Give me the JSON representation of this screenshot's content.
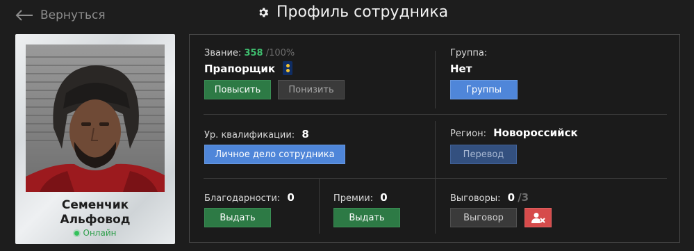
{
  "header": {
    "back_label": "Вернуться",
    "title": "Профиль сотрудника"
  },
  "employee": {
    "first_name": "Семенчик",
    "last_name": "Альфовод",
    "status": "Онлайн"
  },
  "rank": {
    "label": "Звание:",
    "points": "358",
    "points_max": "/100%",
    "name": "Прапорщик",
    "promote_label": "Повысить",
    "demote_label": "Понизить"
  },
  "group": {
    "label": "Группа:",
    "value": "Нет",
    "button_label": "Группы"
  },
  "qualification": {
    "label": "Ур. квалификации:",
    "value": "8",
    "button_label": "Личное дело сотрудника"
  },
  "region": {
    "label": "Регион:",
    "value": "Новороссийск",
    "button_label": "Перевод"
  },
  "thanks": {
    "label": "Благодарности:",
    "value": "0",
    "button_label": "Выдать"
  },
  "bonuses": {
    "label": "Премии:",
    "value": "0",
    "button_label": "Выдать"
  },
  "reprimands": {
    "label": "Выговоры:",
    "value": "0",
    "max": "/3",
    "button_label": "Выговор"
  },
  "colors": {
    "accent_green": "#3fbf6f",
    "button_green": "#2d7a45",
    "button_blue": "#4f86d9",
    "button_red": "#d64b4b",
    "online": "#33c15b"
  },
  "icons": [
    "back-arrow-icon",
    "gear-icon",
    "shoulder-strap-icon",
    "remove-user-icon"
  ]
}
